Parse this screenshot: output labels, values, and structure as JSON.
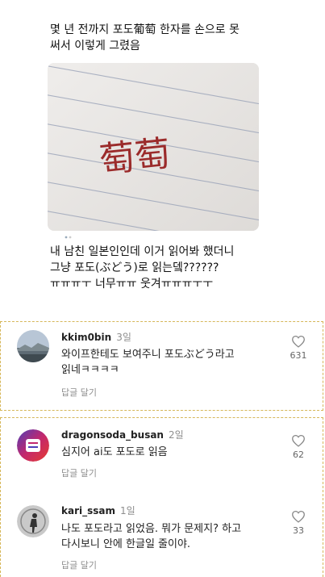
{
  "post": {
    "text_top": "몇 년 전까지 포도葡萄 한자를 손으로 못\n써서 이렇게 그렸음",
    "image_handwriting": "萄萄",
    "text_bottom": "내 남친 일본인인데 이거 읽어봐 했더니\n그냥 포도(ぶどう)로 읽는뎈??????\nㅠㅠㅠㅜ 너무ㅠㅠ 웃겨ㅠㅠㅠㅜㅜ"
  },
  "comments": [
    {
      "username": "kkim0bin",
      "time": "3일",
      "text": "와이프한테도 보여주니 포도ぶどう라고\n읽네ㅋㅋㅋㅋ",
      "reply_label": "답글 달기",
      "likes": "631"
    },
    {
      "username": "dragonsoda_busan",
      "time": "2일",
      "text": "심지어 ai도 포도로 읽음",
      "reply_label": "답글 달기",
      "likes": "62"
    },
    {
      "username": "kari_ssam",
      "time": "1일",
      "text": "나도 포도라고 읽었음. 뭐가 문제지? 하고\n다시보니 안에 한글일 줄이야.",
      "reply_label": "답글 달기",
      "likes": "33"
    }
  ],
  "colors": {
    "dashed_border": "#d6b75a",
    "ink": "#9b2b2b",
    "secondary_text": "#8e8e8e"
  },
  "icons": [
    "heart-icon",
    "avatar"
  ]
}
